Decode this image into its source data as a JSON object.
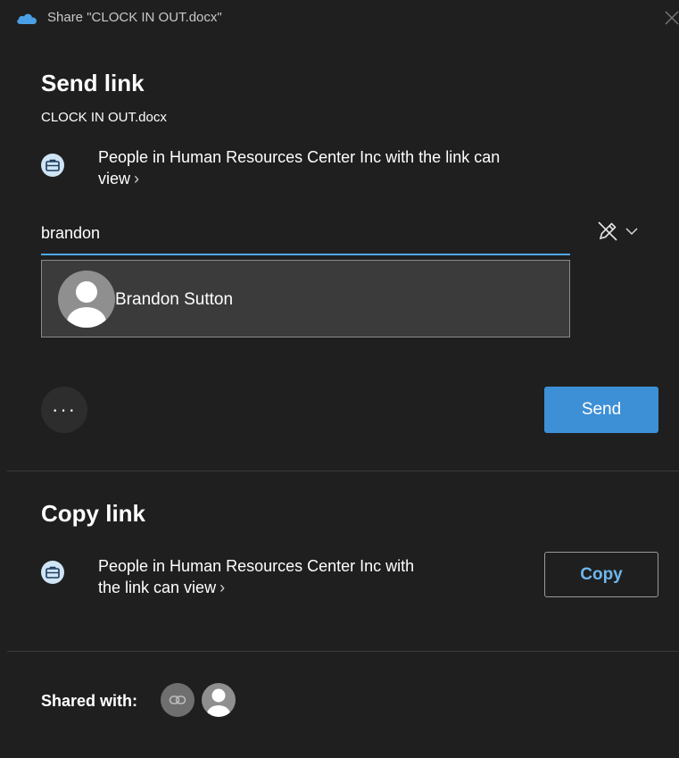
{
  "window": {
    "title": "Share \"CLOCK IN OUT.docx\"",
    "close_icon": "close-icon",
    "app_icon": "onedrive-cloud-icon"
  },
  "send_link": {
    "heading": "Send link",
    "filename": "CLOCK IN OUT.docx",
    "permission_text": "People in Human Resources Center Inc with the link can",
    "permission_text_line2": "view",
    "permission_icon": "briefcase-icon",
    "chevron": "›",
    "recipient_input_value": "brandon",
    "edit_permission_icon": "pencil-slash-icon",
    "dropdown_icon": "chevron-down-icon",
    "suggestion": {
      "name": "Brandon Sutton",
      "avatar_icon": "person-avatar-icon"
    },
    "more_options_label": "···",
    "send_button_label": "Send"
  },
  "copy_link": {
    "heading": "Copy link",
    "permission_text": "People in Human Resources Center Inc with",
    "permission_text_line2": "the link can view",
    "permission_icon": "briefcase-icon",
    "chevron": "›",
    "copy_button_label": "Copy"
  },
  "shared_with": {
    "label": "Shared with:",
    "avatars": [
      "link-icon",
      "person-avatar-icon"
    ]
  },
  "colors": {
    "background": "#1f1f1f",
    "accent": "#3d8fd6",
    "input_underline": "#4ea7e8",
    "copy_text": "#6fb6ee"
  }
}
